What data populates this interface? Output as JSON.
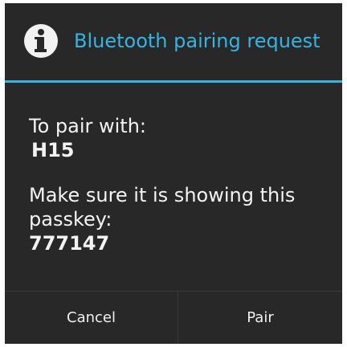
{
  "dialog": {
    "title": "Bluetooth pairing request",
    "title_icon": "info-icon",
    "accent_color": "#33b5e5",
    "background_color": "#282828"
  },
  "message": {
    "pair_with_label": "To pair with:",
    "device_name": "H15",
    "passkey_instruction_line1": "Make sure it is showing this",
    "passkey_instruction_line2": "passkey:",
    "passkey": "777147"
  },
  "buttons": {
    "cancel_label": "Cancel",
    "pair_label": "Pair"
  }
}
